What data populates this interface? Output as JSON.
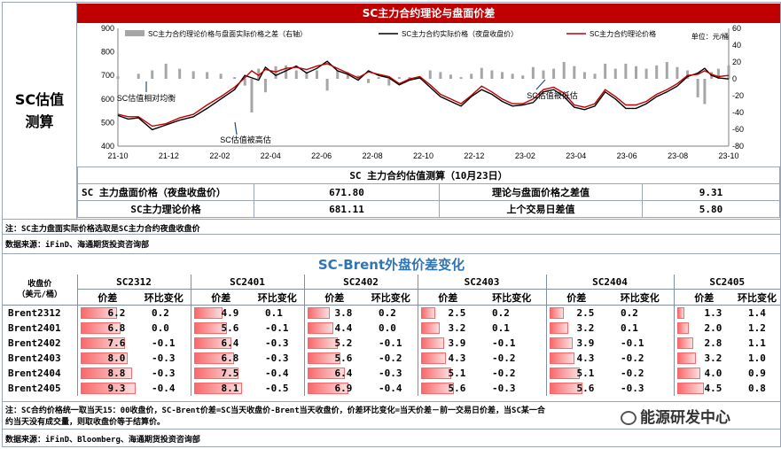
{
  "side_label_line1": "SC估值",
  "side_label_line2": "测算",
  "top_title": "SC主力合约理论与盘面价差",
  "colors": {
    "title_bg": "#c00000",
    "spread_bar": "#a6a6a6",
    "actual_line": "#000000",
    "theory_line": "#c00000",
    "bar_fill": "#f8696b",
    "blue_title": "#2e75b6"
  },
  "chart_data": {
    "type": "line",
    "legend_placement": "top",
    "series": [
      {
        "name": "SC主力合约理论价格与盘面实际价格之差（右轴）",
        "kind": "bar",
        "axis": "right"
      },
      {
        "name": "SC主力合约实际价格（夜盘收盘价）",
        "kind": "line",
        "axis": "left"
      },
      {
        "name": "SC主力合约理论价格",
        "kind": "line",
        "axis": "left"
      }
    ],
    "unit_label": "单位：元/桶",
    "y_left": {
      "ylim": [
        400,
        900
      ],
      "ticks": [
        400,
        500,
        600,
        700,
        800,
        900
      ]
    },
    "y_right": {
      "ylim": [
        -80,
        60
      ],
      "ticks": [
        -80,
        -60,
        -40,
        -20,
        0,
        20,
        40,
        60
      ]
    },
    "x_ticks": [
      "21-10",
      "21-12",
      "22-02",
      "22-04",
      "22-06",
      "22-08",
      "22-10",
      "22-12",
      "23-02",
      "23-04",
      "23-06",
      "23-08",
      "23-10"
    ],
    "actual_price": [
      [
        0,
        530
      ],
      [
        3,
        515
      ],
      [
        6,
        520
      ],
      [
        10,
        470
      ],
      [
        14,
        490
      ],
      [
        18,
        510
      ],
      [
        22,
        525
      ],
      [
        26,
        560
      ],
      [
        30,
        600
      ],
      [
        34,
        640
      ],
      [
        37,
        700
      ],
      [
        39,
        690
      ],
      [
        41,
        680
      ],
      [
        43,
        735
      ],
      [
        46,
        700
      ],
      [
        49,
        720
      ],
      [
        52,
        740
      ],
      [
        55,
        710
      ],
      [
        58,
        730
      ],
      [
        61,
        760
      ],
      [
        64,
        720
      ],
      [
        67,
        705
      ],
      [
        70,
        680
      ],
      [
        73,
        720
      ],
      [
        76,
        700
      ],
      [
        79,
        690
      ],
      [
        82,
        660
      ],
      [
        85,
        680
      ],
      [
        88,
        690
      ],
      [
        91,
        650
      ],
      [
        94,
        610
      ],
      [
        97,
        590
      ],
      [
        100,
        570
      ],
      [
        103,
        610
      ],
      [
        106,
        640
      ],
      [
        109,
        620
      ],
      [
        112,
        590
      ],
      [
        115,
        570
      ],
      [
        118,
        575
      ],
      [
        121,
        585
      ],
      [
        124,
        630
      ],
      [
        127,
        640
      ],
      [
        130,
        610
      ],
      [
        133,
        565
      ],
      [
        136,
        555
      ],
      [
        139,
        570
      ],
      [
        142,
        630
      ],
      [
        145,
        600
      ],
      [
        148,
        560
      ],
      [
        151,
        560
      ],
      [
        154,
        580
      ],
      [
        157,
        610
      ],
      [
        160,
        630
      ],
      [
        163,
        655
      ],
      [
        166,
        695
      ],
      [
        169,
        710
      ],
      [
        171,
        730
      ],
      [
        173,
        700
      ],
      [
        175,
        690
      ],
      [
        178,
        685
      ]
    ],
    "theory_price": [
      [
        0,
        535
      ],
      [
        3,
        525
      ],
      [
        6,
        525
      ],
      [
        10,
        485
      ],
      [
        14,
        495
      ],
      [
        18,
        520
      ],
      [
        22,
        535
      ],
      [
        26,
        575
      ],
      [
        30,
        610
      ],
      [
        34,
        650
      ],
      [
        37,
        690
      ],
      [
        39,
        720
      ],
      [
        41,
        700
      ],
      [
        43,
        725
      ],
      [
        46,
        715
      ],
      [
        49,
        730
      ],
      [
        52,
        735
      ],
      [
        55,
        725
      ],
      [
        58,
        740
      ],
      [
        61,
        750
      ],
      [
        64,
        730
      ],
      [
        67,
        710
      ],
      [
        70,
        690
      ],
      [
        73,
        715
      ],
      [
        76,
        705
      ],
      [
        79,
        695
      ],
      [
        82,
        665
      ],
      [
        85,
        685
      ],
      [
        88,
        695
      ],
      [
        91,
        660
      ],
      [
        94,
        620
      ],
      [
        97,
        600
      ],
      [
        100,
        580
      ],
      [
        103,
        615
      ],
      [
        106,
        655
      ],
      [
        109,
        630
      ],
      [
        112,
        600
      ],
      [
        115,
        580
      ],
      [
        118,
        580
      ],
      [
        121,
        600
      ],
      [
        124,
        640
      ],
      [
        127,
        650
      ],
      [
        130,
        625
      ],
      [
        133,
        575
      ],
      [
        136,
        565
      ],
      [
        139,
        580
      ],
      [
        142,
        640
      ],
      [
        145,
        610
      ],
      [
        148,
        575
      ],
      [
        151,
        575
      ],
      [
        154,
        590
      ],
      [
        157,
        620
      ],
      [
        160,
        640
      ],
      [
        163,
        665
      ],
      [
        166,
        700
      ],
      [
        169,
        705
      ],
      [
        171,
        720
      ],
      [
        173,
        705
      ],
      [
        175,
        695
      ],
      [
        178,
        700
      ]
    ],
    "spread": [
      [
        0,
        3
      ],
      [
        6,
        6
      ],
      [
        10,
        10
      ],
      [
        14,
        18
      ],
      [
        18,
        12
      ],
      [
        22,
        9
      ],
      [
        26,
        8
      ],
      [
        30,
        6
      ],
      [
        34,
        2
      ],
      [
        37,
        -8
      ],
      [
        39,
        -40
      ],
      [
        41,
        12
      ],
      [
        43,
        -16
      ],
      [
        46,
        15
      ],
      [
        49,
        16
      ],
      [
        52,
        10
      ],
      [
        55,
        8
      ],
      [
        58,
        10
      ],
      [
        61,
        -14
      ],
      [
        64,
        10
      ],
      [
        67,
        8
      ],
      [
        70,
        4
      ],
      [
        73,
        -5
      ],
      [
        76,
        2
      ],
      [
        79,
        -8
      ],
      [
        82,
        2
      ],
      [
        85,
        2
      ],
      [
        88,
        2
      ],
      [
        91,
        10
      ],
      [
        94,
        8
      ],
      [
        97,
        5
      ],
      [
        100,
        2
      ],
      [
        103,
        6
      ],
      [
        106,
        13
      ],
      [
        109,
        10
      ],
      [
        112,
        8
      ],
      [
        115,
        6
      ],
      [
        118,
        4
      ],
      [
        121,
        14
      ],
      [
        124,
        10
      ],
      [
        127,
        12
      ],
      [
        130,
        20
      ],
      [
        133,
        15
      ],
      [
        136,
        8
      ],
      [
        139,
        6
      ],
      [
        142,
        18
      ],
      [
        145,
        12
      ],
      [
        148,
        18
      ],
      [
        151,
        15
      ],
      [
        154,
        12
      ],
      [
        157,
        16
      ],
      [
        160,
        20
      ],
      [
        163,
        14
      ],
      [
        166,
        10
      ],
      [
        169,
        -22
      ],
      [
        171,
        -30
      ],
      [
        173,
        8
      ],
      [
        175,
        12
      ],
      [
        178,
        16
      ]
    ],
    "annotations": [
      "SC估值相对均衡",
      "SC估值被高估",
      "SC估值被低估"
    ]
  },
  "est_table": {
    "title": "SC 主力合约估值测算（10月23日）",
    "r1_l": "SC 主力盘面价格（夜盘收盘价）",
    "r1_v": "671.80",
    "r1_l2": "理论与盘面价格之差值",
    "r1_v2": "9.31",
    "r2_l": "SC主力理论价格",
    "r2_v": "681.11",
    "r2_l2": "上个交易日差值",
    "r2_v2": "5.80"
  },
  "note1": "注：SC主力盘面实际价格选取是SC主力合约夜盘收盘价",
  "source1": "数据来源：iFinD、海通期货投资咨询部",
  "brent_title": "SC-Brent外盘价差变化",
  "spread_table": {
    "header_left_1": "收盘价",
    "header_left_2": "（美元/桶）",
    "contracts": [
      "SC2312",
      "SC2401",
      "SC2402",
      "SC2403",
      "SC2404",
      "SC2405"
    ],
    "sub_spread": "价差",
    "sub_change": "环比变化",
    "rows": [
      {
        "name": "Brent2312",
        "cells": [
          [
            "6.2",
            "0.2"
          ],
          [
            "4.9",
            "0.1"
          ],
          [
            "3.8",
            "0.2"
          ],
          [
            "2.5",
            "0.2"
          ],
          [
            "2.5",
            "0.2"
          ],
          [
            "1.3",
            "1.4"
          ]
        ]
      },
      {
        "name": "Brent2401",
        "cells": [
          [
            "6.8",
            "0.0"
          ],
          [
            "5.6",
            "-0.1"
          ],
          [
            "4.4",
            "0.0"
          ],
          [
            "3.2",
            "0.1"
          ],
          [
            "3.2",
            "0.1"
          ],
          [
            "2.0",
            "1.2"
          ]
        ]
      },
      {
        "name": "Brent2402",
        "cells": [
          [
            "7.6",
            "-0.1"
          ],
          [
            "6.4",
            "-0.3"
          ],
          [
            "5.2",
            "-0.1"
          ],
          [
            "3.9",
            "-0.1"
          ],
          [
            "3.9",
            "-0.1"
          ],
          [
            "2.8",
            "1.1"
          ]
        ]
      },
      {
        "name": "Brent2403",
        "cells": [
          [
            "8.0",
            "-0.3"
          ],
          [
            "6.8",
            "-0.3"
          ],
          [
            "5.6",
            "-0.2"
          ],
          [
            "4.3",
            "-0.2"
          ],
          [
            "4.3",
            "-0.2"
          ],
          [
            "3.2",
            "1.0"
          ]
        ]
      },
      {
        "name": "Brent2404",
        "cells": [
          [
            "8.8",
            "-0.3"
          ],
          [
            "7.5",
            "-0.4"
          ],
          [
            "6.4",
            "-0.3"
          ],
          [
            "5.1",
            "-0.2"
          ],
          [
            "5.1",
            "-0.2"
          ],
          [
            "4.0",
            "0.9"
          ]
        ]
      },
      {
        "name": "Brent2405",
        "cells": [
          [
            "9.3",
            "-0.4"
          ],
          [
            "8.1",
            "-0.5"
          ],
          [
            "6.9",
            "-0.4"
          ],
          [
            "5.6",
            "-0.3"
          ],
          [
            "5.6",
            "-0.3"
          ],
          [
            "4.5",
            "0.8"
          ]
        ]
      }
    ]
  },
  "note2_line1": "注：SC合约价格统一取当天15：00收盘价，SC-Brent价差=SC当天收盘价-Brent当天收盘价，价差环比变化=当天价差－前一交易日价差，当SC某一合",
  "note2_line2": "约当天没有成交量，则取收盘价等于结算价。",
  "source2": "数据来源：iFinD、Bloomberg、海通期货投资咨询部",
  "watermark": "能源研发中心"
}
